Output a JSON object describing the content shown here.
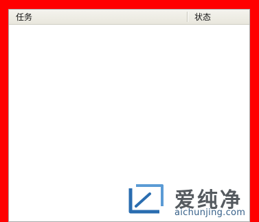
{
  "colors": {
    "background": "#ff0000",
    "list_background": "#ffffff",
    "header_background": "#ece9d8"
  },
  "list": {
    "columns": [
      {
        "label": "任务"
      },
      {
        "label": "状态"
      }
    ],
    "rows": []
  },
  "watermark": {
    "name": "爱纯净",
    "url": "aichunjing.com",
    "icon": "aichunjing-logo-icon"
  }
}
